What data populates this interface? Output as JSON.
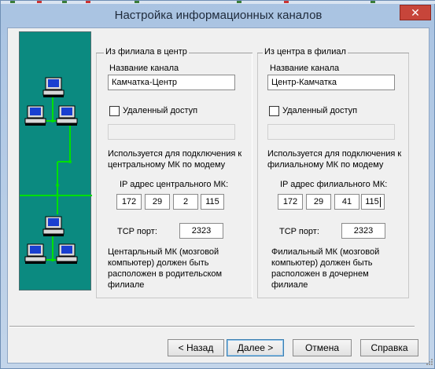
{
  "window": {
    "title": "Настройка информационных каналов",
    "close_label": "✕"
  },
  "left_group": {
    "title": "Из филиала в центр",
    "channel_name_label": "Название канала",
    "channel_name_value": "Камчатка-Центр",
    "remote_access_label": "Удаленный доступ",
    "remote_access_checked": false,
    "modem_note": "Используется для подключения к центральному МК по модему",
    "ip_label": "IP адрес центрального МК:",
    "ip": [
      "172",
      "29",
      "2",
      "115"
    ],
    "tcp_label": "TCP порт:",
    "tcp_value": "2323",
    "footer_note": "Центарльный МК (мозговой компьютер) должен быть расположен в родительском филиале"
  },
  "right_group": {
    "title": "Из центра в филиал",
    "channel_name_label": "Название канала",
    "channel_name_value": "Центр-Камчатка",
    "remote_access_label": "Удаленный доступ",
    "remote_access_checked": false,
    "modem_note": "Используется для подключения к филиальному МК по модему",
    "ip_label": "IP адрес филиального МК:",
    "ip": [
      "172",
      "29",
      "41",
      "115"
    ],
    "tcp_label": "TCP порт:",
    "tcp_value": "2323",
    "footer_note": "Филиальный МК (мозговой компьютер) должен быть расположен в дочернем филиале"
  },
  "buttons": {
    "back": "< Назад",
    "next": "Далее >",
    "cancel": "Отмена",
    "help": "Справка"
  },
  "colors": {
    "illustration_bg": "#0b8a80",
    "network_line": "#00e000"
  },
  "icons": [
    "computer-icon",
    "network-illustration"
  ]
}
